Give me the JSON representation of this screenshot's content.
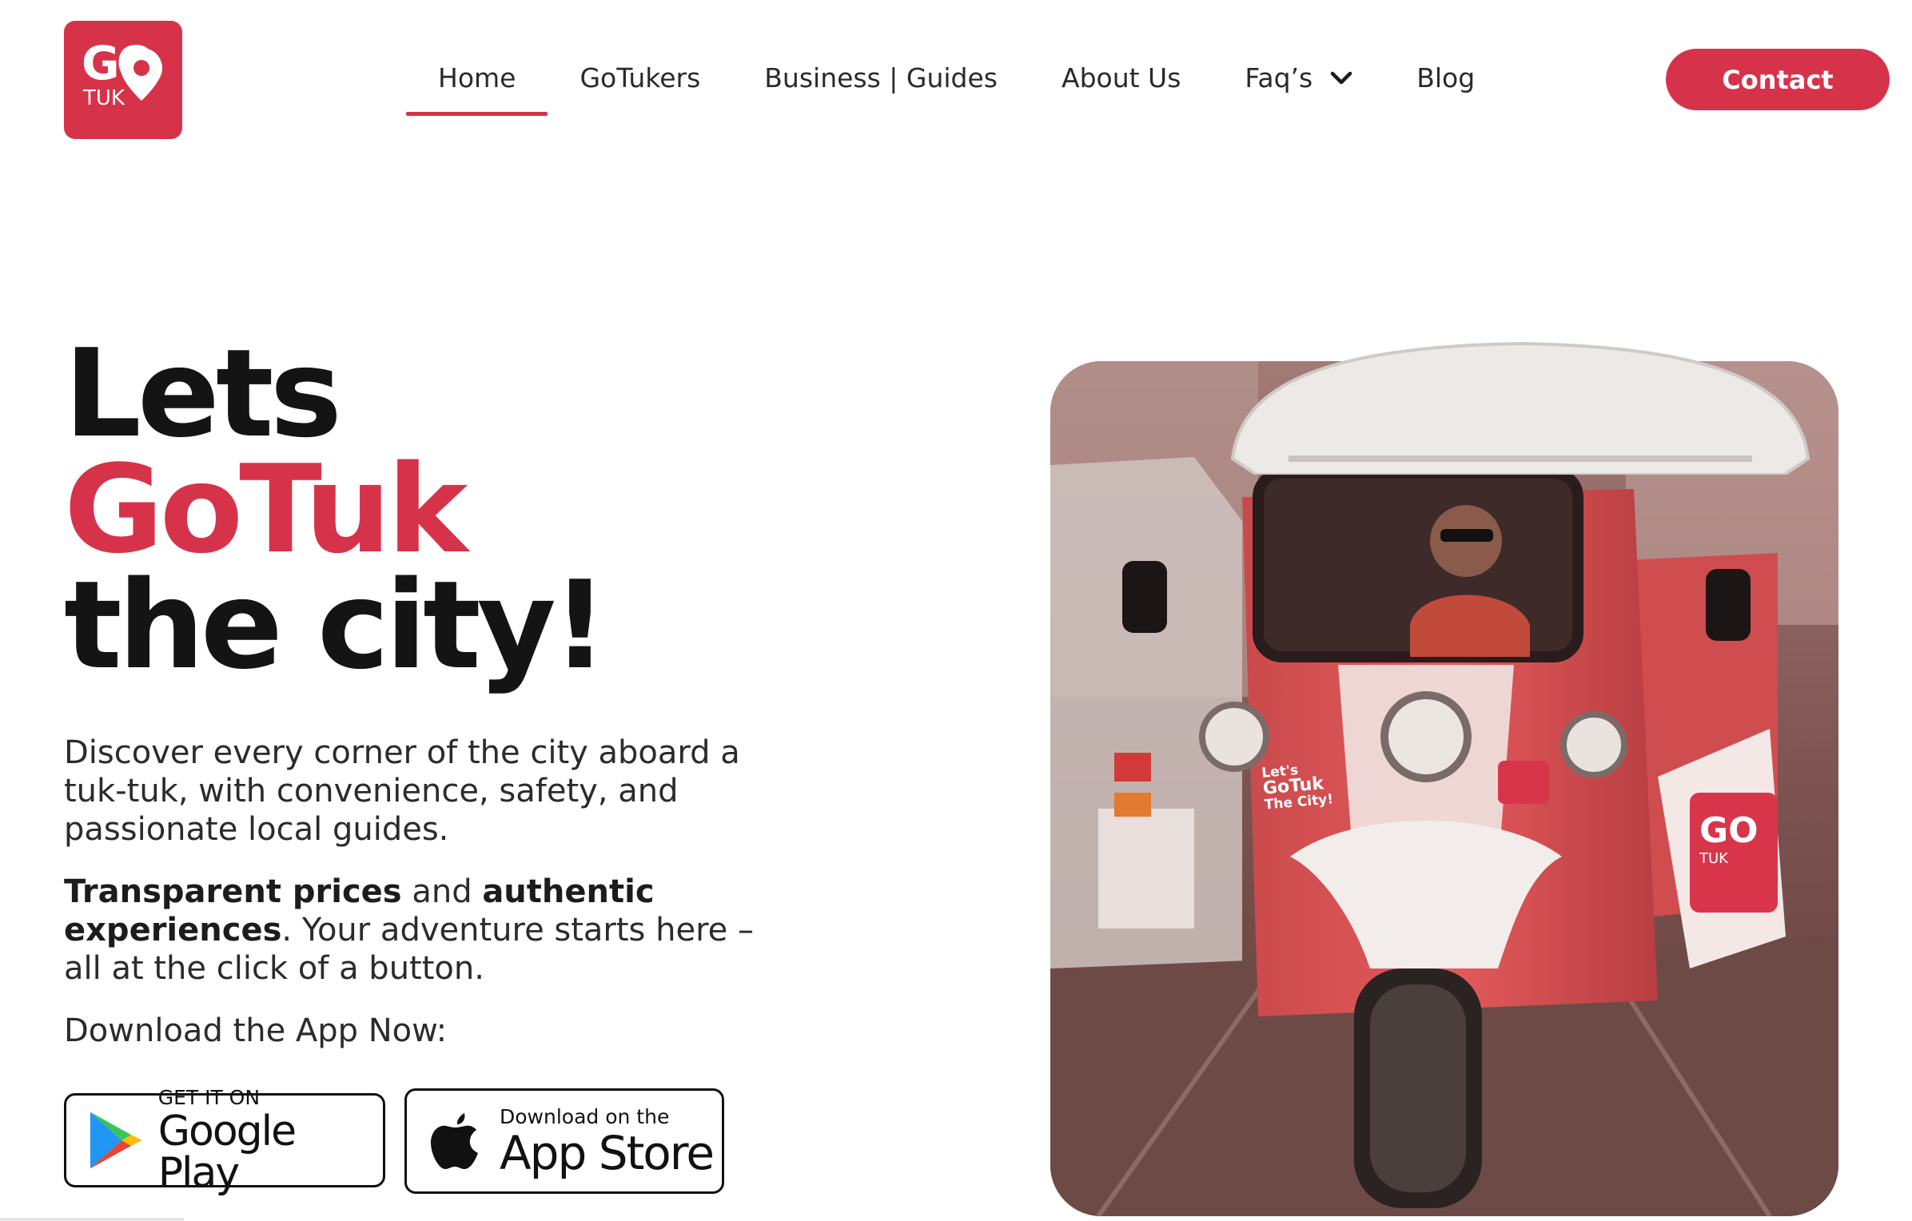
{
  "brand": {
    "logo_text_top": "GO",
    "logo_text_bottom": "TUK",
    "accent_color": "#d6334a"
  },
  "nav": {
    "items": [
      {
        "label": "Home",
        "active": true
      },
      {
        "label": "GoTukers"
      },
      {
        "label": "Business | Guides"
      },
      {
        "label": "About Us"
      },
      {
        "label": "Faq’s",
        "icon": "chevron-down-icon"
      },
      {
        "label": "Blog"
      }
    ],
    "contact_label": "Contact"
  },
  "hero": {
    "title_line1": "Lets",
    "title_line2": "GoTuk",
    "title_line3": "the city!",
    "paragraph1": "Discover every corner of the city aboard a tuk-tuk, with convenience, safety, and passionate local guides.",
    "p2_bold1": "Transparent prices",
    "p2_mid": " and ",
    "p2_bold2": "authentic experiences",
    "p2_rest": ". Your adventure starts here – all at the click of a button.",
    "download_label": "Download the App Now:"
  },
  "stores": {
    "google_small": "GET IT ON",
    "google_big": "Google Play",
    "apple_small": "Download on the",
    "apple_big": "App Store"
  },
  "photo": {
    "tuk_slogan_1": "Let's",
    "tuk_slogan_2": "GoTuk",
    "tuk_slogan_3": "The City!",
    "tuk_logo_text_top": "GO",
    "tuk_logo_text_bottom": "TUK"
  }
}
